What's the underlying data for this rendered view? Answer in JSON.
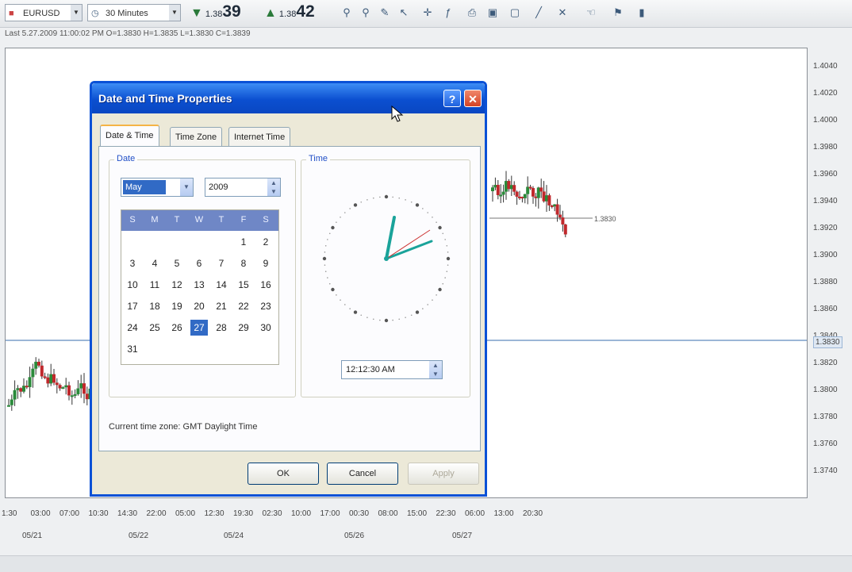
{
  "toolbar": {
    "symbol": "EURUSD",
    "timeframe": "30 Minutes",
    "sell_prefix": "1.38",
    "sell_big": "39",
    "buy_prefix": "1.38",
    "buy_big": "42"
  },
  "last_info": "Last 5.27.2009 11:00:02 PM O=1.3830 H=1.3835 L=1.3830 C=1.3839",
  "chart": {
    "current_price_label": "1.3830",
    "line_label": "1.3830",
    "y_ticks": [
      "1.4040",
      "1.4020",
      "1.4000",
      "1.3980",
      "1.3960",
      "1.3940",
      "1.3920",
      "1.3900",
      "1.3880",
      "1.3860",
      "1.3840",
      "1.3820",
      "1.3800",
      "1.3780",
      "1.3760",
      "1.3740"
    ],
    "x_ticks": [
      "1:30",
      "03:00",
      "07:00",
      "10:30",
      "14:30",
      "22:00",
      "05:00",
      "12:30",
      "19:30",
      "02:30",
      "10:00",
      "17:00",
      "00:30",
      "08:00",
      "15:00",
      "22:30",
      "06:00",
      "13:00",
      "20:30"
    ],
    "x_dates": [
      "05/21",
      "05/22",
      "05/24",
      "05/26",
      "05/27"
    ]
  },
  "dialog": {
    "title": "Date and Time Properties",
    "help_label": "?",
    "close_label": "✕",
    "tabs": [
      "Date & Time",
      "Time Zone",
      "Internet Time"
    ],
    "date_group": "Date",
    "time_group": "Time",
    "month": "May",
    "year": "2009",
    "weekdays": [
      "S",
      "M",
      "T",
      "W",
      "T",
      "F",
      "S"
    ],
    "days": [
      "1",
      "2",
      "3",
      "4",
      "5",
      "6",
      "7",
      "8",
      "9",
      "10",
      "11",
      "12",
      "13",
      "14",
      "15",
      "16",
      "17",
      "18",
      "19",
      "20",
      "21",
      "22",
      "23",
      "24",
      "25",
      "26",
      "27",
      "28",
      "29",
      "30",
      "31"
    ],
    "selected_day": "27",
    "time_value": "12:12:30 AM",
    "timezone_text": "Current time zone:  GMT Daylight Time",
    "ok_label": "OK",
    "cancel_label": "Cancel",
    "apply_label": "Apply"
  },
  "colors": {
    "title_blue": "#0b4fd0",
    "candle_up": "#2a8a3a",
    "candle_down": "#c0282c",
    "price_line": "#9bb6d6"
  }
}
